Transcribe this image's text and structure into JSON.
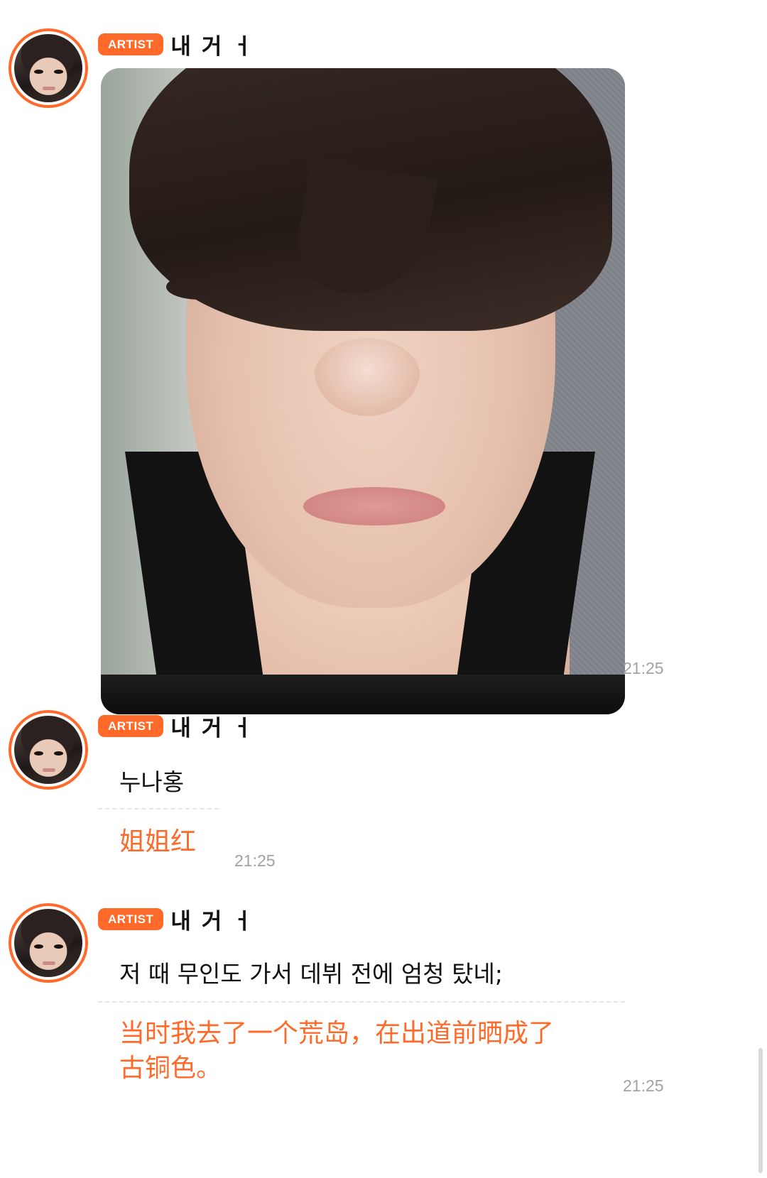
{
  "colors": {
    "accent": "#ff6a2a",
    "timestamp": "#a2a2a2",
    "text": "#111111"
  },
  "messages": [
    {
      "badge": "ARTIST",
      "sender": "내 거 ㅓ",
      "type": "image",
      "image_alt": "selfie-photo",
      "time": "21:25"
    },
    {
      "badge": "ARTIST",
      "sender": "내 거 ㅓ",
      "type": "text",
      "original": "누나홍",
      "translation": "姐姐红",
      "time": "21:25"
    },
    {
      "badge": "ARTIST",
      "sender": "내 거 ㅓ",
      "type": "text",
      "original": "저 때 무인도 가서 데뷔 전에 엄청 탔네;",
      "translation_line1": "当时我去了一个荒岛，在出道前晒成了",
      "translation_line2": "古铜色。",
      "time": "21:25"
    }
  ]
}
